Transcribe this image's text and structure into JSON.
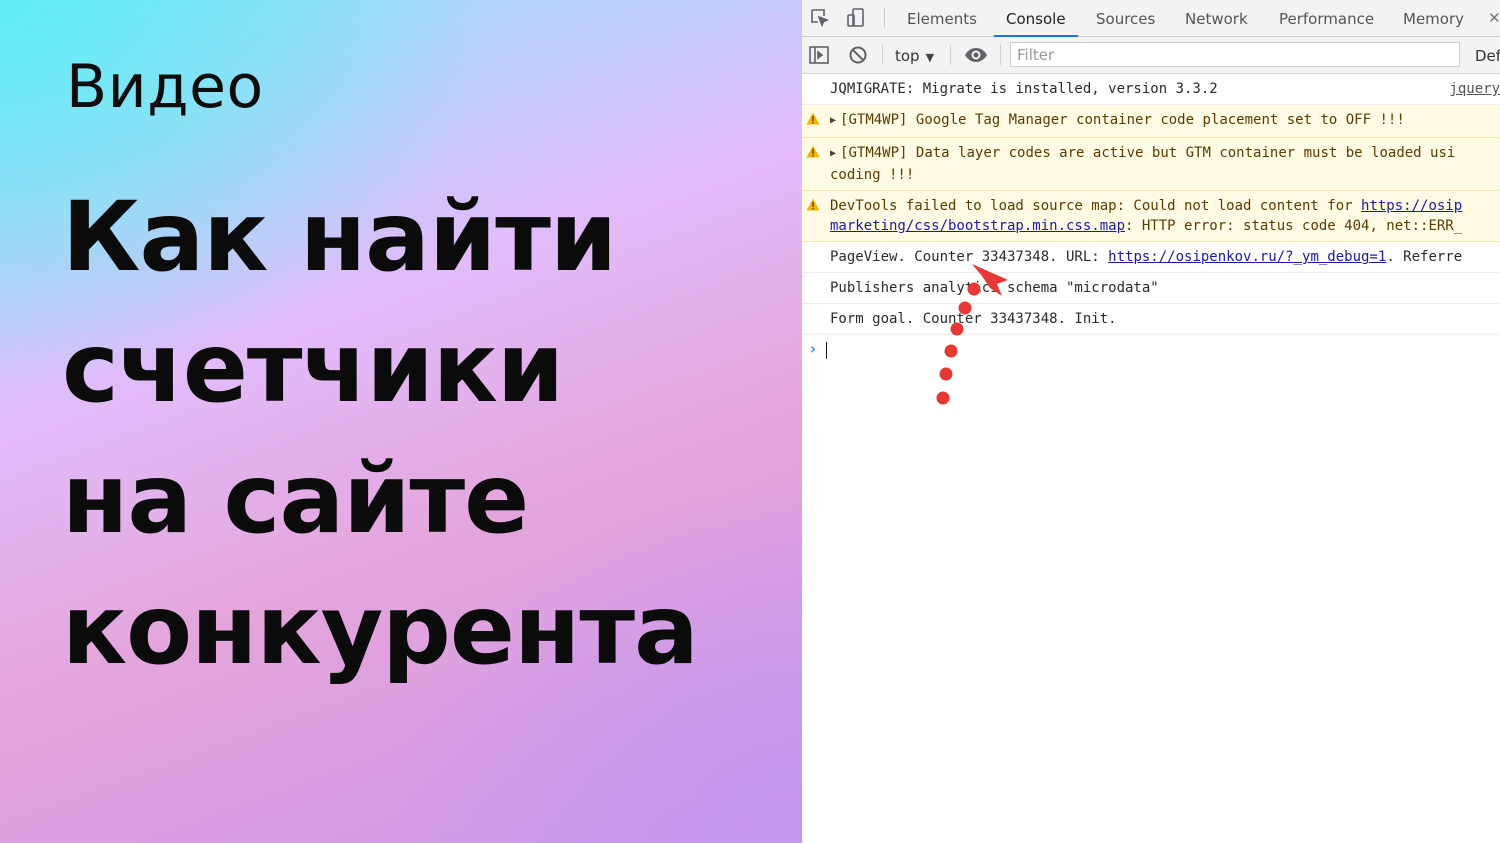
{
  "promo": {
    "kicker": "Видео",
    "headline": [
      "Как найти",
      "счетчики",
      "на сайте",
      "конкурента"
    ]
  },
  "devtools": {
    "tabs": [
      "Elements",
      "Console",
      "Sources",
      "Network",
      "Performance",
      "Memory"
    ],
    "active_tab": "Console",
    "toolbar": {
      "context": "top",
      "filter_placeholder": "Filter",
      "levels_label": "Def"
    },
    "messages": [
      {
        "type": "info",
        "text": "JQMIGRATE: Migrate is installed, version 3.3.2",
        "source": "jquery"
      },
      {
        "type": "warning",
        "text": "[GTM4WP] Google Tag Manager container code placement set to OFF !!!"
      },
      {
        "type": "warning",
        "text": "[GTM4WP] Data layer codes are active but GTM container must be loaded usi",
        "text2": "coding !!!"
      },
      {
        "type": "warning",
        "prefix": "DevTools failed to load source map: Could not load content for ",
        "link": "https://osip",
        "link2": "marketing/css/bootstrap.min.css.map",
        "suffix2": ": HTTP error: status code 404, net::ERR_"
      },
      {
        "type": "info",
        "prefix": "PageView. Counter 33437348. URL: ",
        "link": "https://osipenkov.ru/?_ym_debug=1",
        "suffix": ". Referre"
      },
      {
        "type": "info",
        "text": "Publishers analytics schema \"microdata\""
      },
      {
        "type": "info",
        "text": "Form goal. Counter 33437348. Init."
      }
    ],
    "prompt_symbol": "›"
  },
  "colors": {
    "accent_tab": "#1a73e8",
    "warning_bg": "#fffbe5",
    "annotation": "#e53935"
  }
}
